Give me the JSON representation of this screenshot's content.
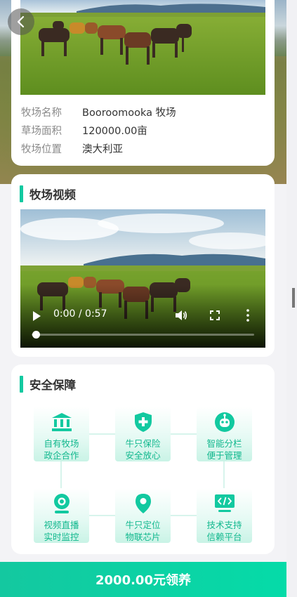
{
  "ranch_info": {
    "rows": [
      {
        "key": "牧场名称",
        "value": "Booroomooka 牧场"
      },
      {
        "key": "草场面积",
        "value": "120000.00亩"
      },
      {
        "key": "牧场位置",
        "value": "澳大利亚"
      }
    ]
  },
  "video_section": {
    "title": "牧场视频",
    "time": "0:00 / 0:57",
    "progress": 0
  },
  "safety_section": {
    "title": "安全保障",
    "features": [
      {
        "line1": "自有牧场",
        "line2": "政企合作",
        "icon": "bank-icon"
      },
      {
        "line1": "牛只保险",
        "line2": "安全放心",
        "icon": "shield-plus-icon"
      },
      {
        "line1": "智能分栏",
        "line2": "便于管理",
        "icon": "robot-icon"
      },
      {
        "line1": "视频直播",
        "line2": "实时监控",
        "icon": "webcam-icon"
      },
      {
        "line1": "牛只定位",
        "line2": "物联芯片",
        "icon": "location-pin-icon"
      },
      {
        "line1": "技术支持",
        "line2": "信赖平台",
        "icon": "code-monitor-icon"
      }
    ]
  },
  "cta": {
    "label": "2000.00元领养"
  },
  "colors": {
    "accent": "#12c9a0",
    "accent_text": "#12b88e"
  }
}
